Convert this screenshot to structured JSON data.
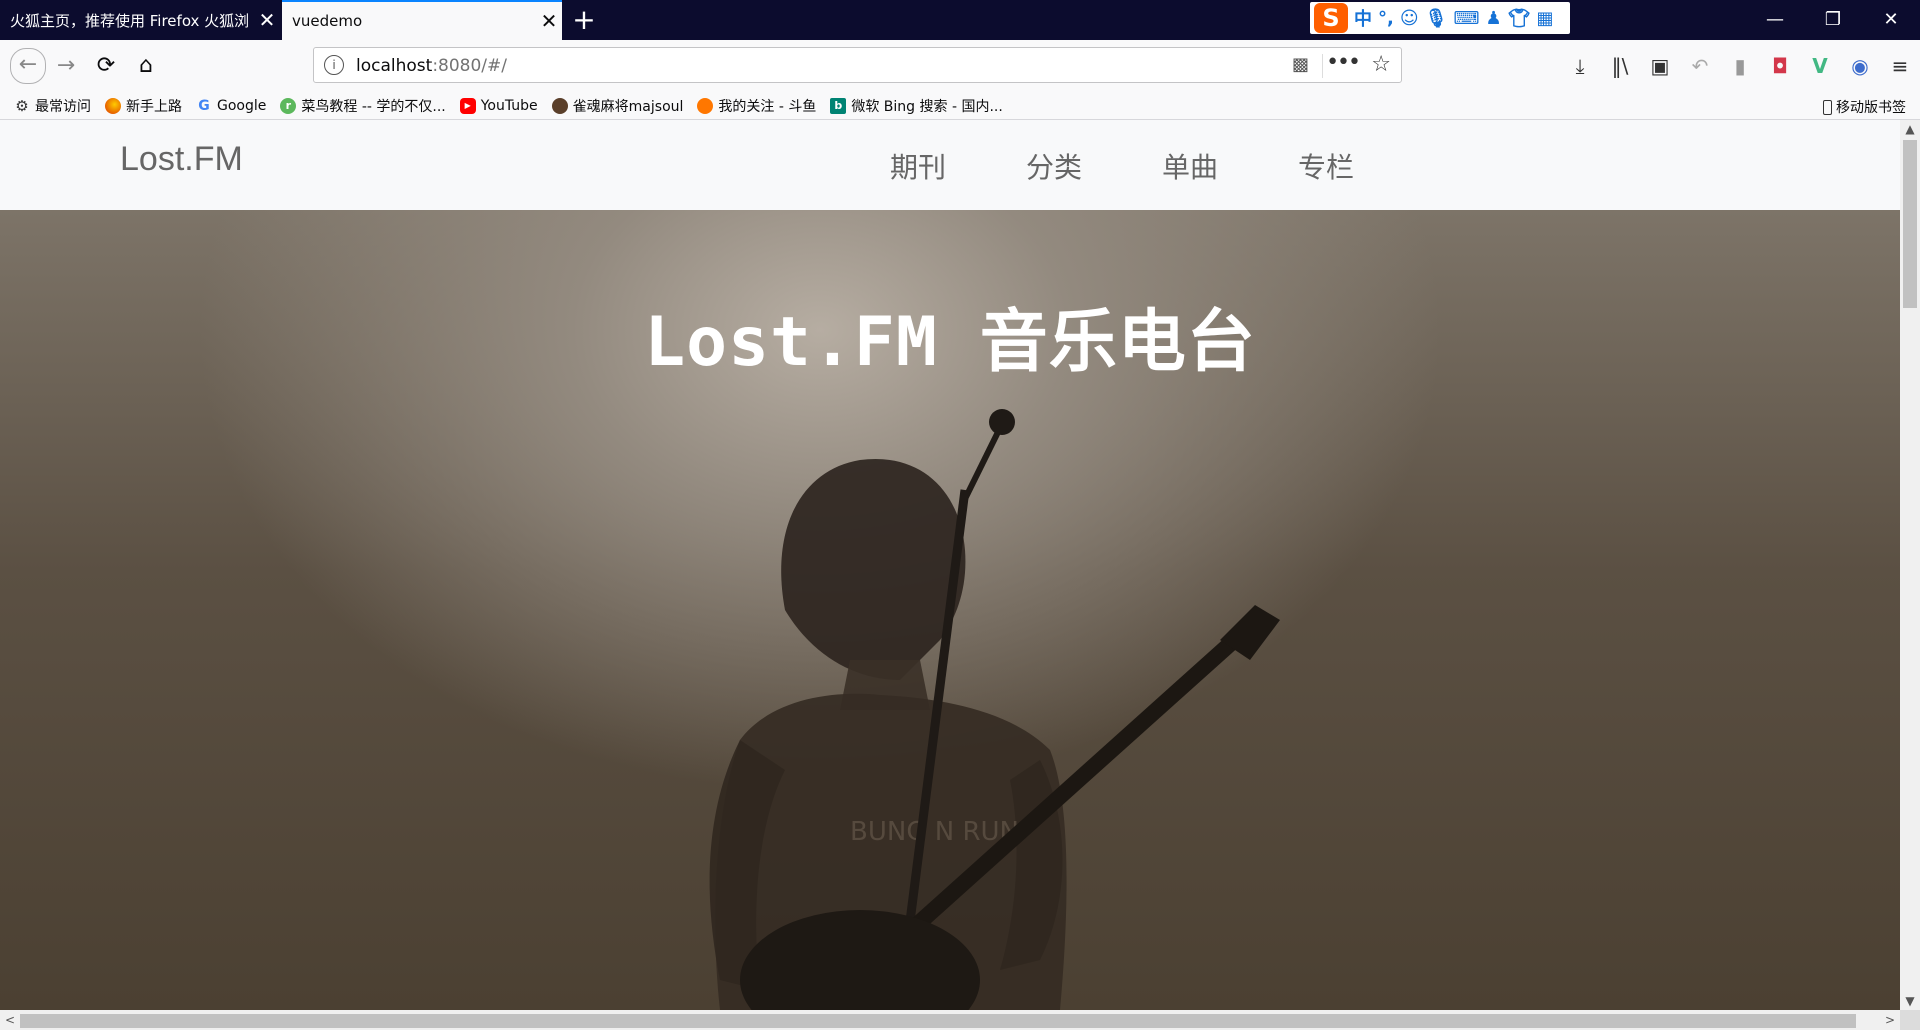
{
  "tabs": [
    {
      "title": "火狐主页，推荐使用 Firefox 火狐浏",
      "active": false
    },
    {
      "title": "vuedemo",
      "active": true
    }
  ],
  "tab_close_glyph": "✕",
  "new_tab_glyph": "+",
  "ime": {
    "logo": "S",
    "mode": "中",
    "punct": "°,"
  },
  "window_controls": {
    "minimize": "—",
    "restore": "❐",
    "close": "✕"
  },
  "nav": {
    "back": "←",
    "forward": "→",
    "reload": "⟳",
    "home": "⌂",
    "url_host": "localhost",
    "url_rest": ":8080/#/",
    "page_actions": "•••",
    "bookmark_star": "☆"
  },
  "toolbar_icons": [
    "download-icon",
    "library-icon",
    "sidebar-icon",
    "undo-icon",
    "extension-icon",
    "pocket-icon",
    "vue-devtools-icon",
    "sync-icon",
    "menu-icon"
  ],
  "toolbar_glyphs": [
    "⤓",
    "‖\\",
    "▣",
    "↶",
    "▮",
    "◘",
    "V",
    "◉",
    "≡"
  ],
  "bookmarks": [
    {
      "label": "最常访问",
      "icon": "gear-icon",
      "glyph": "⚙",
      "color": "#333333"
    },
    {
      "label": "新手上路",
      "icon": "firefox-icon",
      "glyph": "",
      "color": "#e66000"
    },
    {
      "label": "Google",
      "icon": "google-icon",
      "glyph": "G",
      "color": "#4285f4"
    },
    {
      "label": "菜鸟教程 -- 学的不仅...",
      "icon": "runoob-icon",
      "glyph": "r",
      "color": "#5cb85c"
    },
    {
      "label": "YouTube",
      "icon": "youtube-icon",
      "glyph": "▶",
      "color": "#ff0000"
    },
    {
      "label": "雀魂麻将majsoul",
      "icon": "majsoul-icon",
      "glyph": "",
      "color": "#5a3f2a"
    },
    {
      "label": "我的关注 - 斗鱼",
      "icon": "douyu-icon",
      "glyph": "",
      "color": "#ff7700"
    },
    {
      "label": "微软 Bing 搜索 - 国内...",
      "icon": "bing-icon",
      "glyph": "b",
      "color": "#008373"
    }
  ],
  "mobile_bookmarks": "移动版书签",
  "site": {
    "brand": "Lost.FM",
    "nav": [
      "期刊",
      "分类",
      "单曲",
      "专栏"
    ],
    "hero_title": "Lost.FM 音乐电台"
  },
  "scroll": {
    "up": "▲",
    "down": "▼",
    "left": "<",
    "right": ">"
  }
}
